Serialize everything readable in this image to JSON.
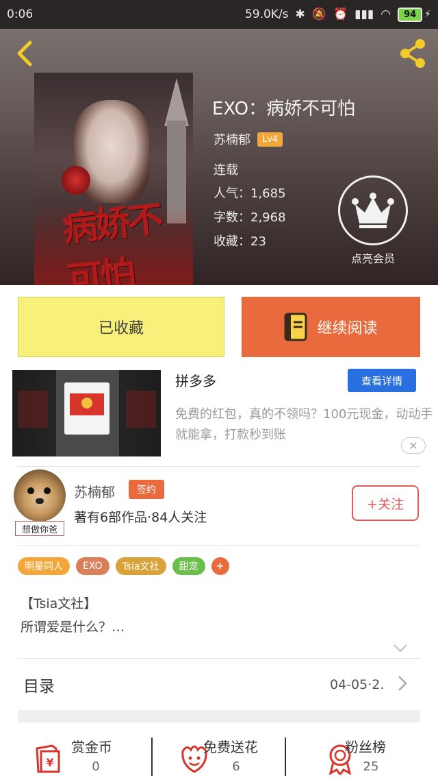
{
  "status_bar": {
    "time": "0:06",
    "net_speed": "59.0K/s",
    "battery": "94"
  },
  "book": {
    "title": "EXO：病娇不可怕",
    "author": "苏楠郁",
    "level": "Lv4",
    "status": "连载",
    "popularity": "人气：1,685",
    "word_count": "字数：2,968",
    "favorites": "收藏：23",
    "cover_text": "病娇不可怕"
  },
  "vip": {
    "label": "点亮会员"
  },
  "actions": {
    "favorited_label": "已收藏",
    "continue_label": "继续阅读"
  },
  "ad": {
    "title": "拼多多",
    "detail_button": "查看详情",
    "description": "免费的红包，真的不领吗？100元现金，动动手就能拿，打款秒到账",
    "close": "✕"
  },
  "author_card": {
    "name": "苏楠郁",
    "signed_badge": "签约",
    "stats": "著有6部作品·84人关注",
    "follow_button": "+关注",
    "avatar_caption": "想做你爸"
  },
  "tags": [
    {
      "label": "明星同人",
      "color": "#f3a73a"
    },
    {
      "label": "EXO",
      "color": "#d9805a"
    },
    {
      "label": "Tsia文社",
      "color": "#d9a23a"
    },
    {
      "label": "甜宠",
      "color": "#6abf4b"
    },
    {
      "label": "+",
      "color": "#e96a3c"
    }
  ],
  "intro": {
    "line1": "【Tsia文社】",
    "line2": "所谓爱是什么？…"
  },
  "toc": {
    "label": "目录",
    "date": "04-05·2."
  },
  "bottom_bar": [
    {
      "label": "赏金币",
      "count": "0",
      "icon": "reward-coin-icon"
    },
    {
      "label": "免费送花",
      "count": "6",
      "icon": "flower-icon"
    },
    {
      "label": "粉丝榜",
      "count": "25",
      "icon": "fan-ranking-icon"
    }
  ],
  "colors": {
    "accent_orange": "#e96a3c",
    "fav_yellow": "#f8f07a",
    "back_arrow": "#f3cc2a",
    "link_blue": "#2a6fe0",
    "follow_red": "#e05a5a"
  }
}
